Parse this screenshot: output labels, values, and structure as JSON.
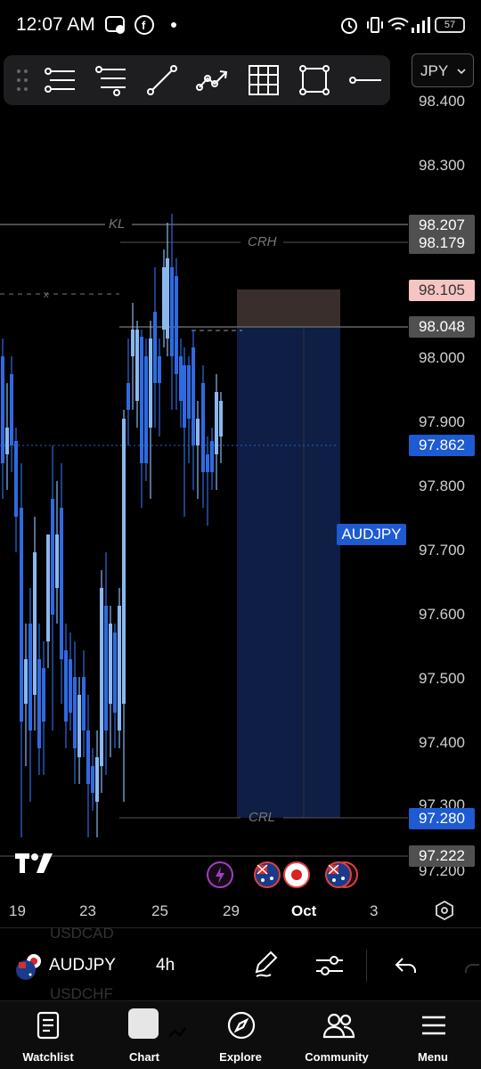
{
  "status_bar": {
    "time": "12:07 AM",
    "battery": "57"
  },
  "currency_select": {
    "value": "JPY"
  },
  "price_axis": {
    "labels": [
      "98.400",
      "98.300",
      "98.000",
      "97.900",
      "97.800",
      "97.700",
      "97.600",
      "97.500",
      "97.400",
      "97.300",
      "97.200"
    ]
  },
  "price_tags": {
    "kl": "98.207",
    "crh": "98.179",
    "stop": "98.105",
    "entry": "98.048",
    "current": "97.862",
    "crl": "97.280",
    "low": "97.222"
  },
  "symbol_tag": "AUDJPY",
  "chart_lines": {
    "kl": "KL",
    "crh": "CRH",
    "crl": "CRL"
  },
  "date_axis": [
    "19",
    "23",
    "25",
    "29",
    "Oct",
    "3"
  ],
  "symbol_bar": {
    "ghost_above": "USDCAD",
    "ghost_below": "USDCHF",
    "symbol": "AUDJPY",
    "timeframe": "4h"
  },
  "nav": {
    "watchlist": "Watchlist",
    "chart": "Chart",
    "explore": "Explore",
    "community": "Community",
    "menu": "Menu"
  },
  "colors": {
    "bull_candle": "#8ab8ee",
    "bear_candle": "#2f6ae0",
    "accent": "#1e5ad2",
    "position_fill": "#0e1e44",
    "stop_fill": "#3a2e2c"
  }
}
